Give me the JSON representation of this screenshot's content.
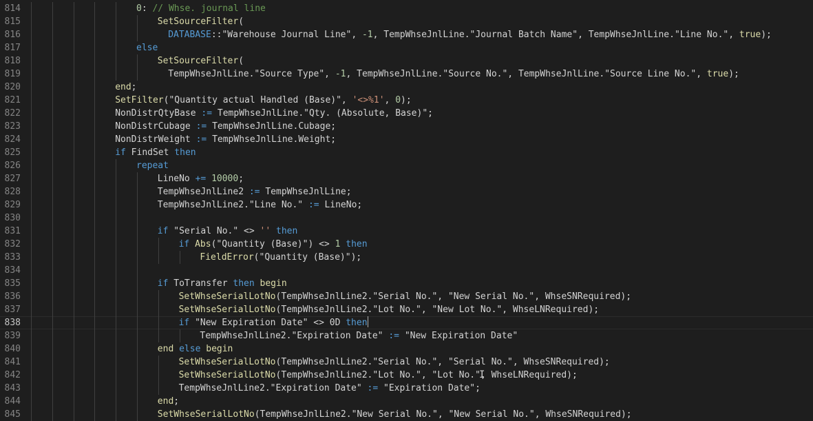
{
  "editor": {
    "lines": [
      {
        "n": "814",
        "indent": 5,
        "parts": [
          [
            "0",
            "num"
          ],
          [
            ": ",
            "plain"
          ],
          [
            "// Whse. journal line",
            "cmt"
          ]
        ]
      },
      {
        "n": "815",
        "indent": 6,
        "parts": [
          [
            "SetSourceFilter",
            "fn"
          ],
          [
            "(",
            "plain"
          ]
        ]
      },
      {
        "n": "816",
        "indent": 6.5,
        "parts": [
          [
            "DATABASE",
            "kw"
          ],
          [
            "::",
            "plain"
          ],
          [
            "\"Warehouse Journal Line\"",
            "plain"
          ],
          [
            ", ",
            "plain"
          ],
          [
            "-1",
            "num"
          ],
          [
            ", ",
            "plain"
          ],
          [
            "TempWhseJnlLine",
            "plain"
          ],
          [
            ".",
            "plain"
          ],
          [
            "\"Journal Batch Name\"",
            "plain"
          ],
          [
            ", ",
            "plain"
          ],
          [
            "TempWhseJnlLine",
            "plain"
          ],
          [
            ".",
            "plain"
          ],
          [
            "\"Line No.\"",
            "plain"
          ],
          [
            ", ",
            "plain"
          ],
          [
            "true",
            "fn"
          ],
          [
            ");",
            "plain"
          ]
        ]
      },
      {
        "n": "817",
        "indent": 5,
        "parts": [
          [
            "else",
            "kw"
          ]
        ]
      },
      {
        "n": "818",
        "indent": 6,
        "parts": [
          [
            "SetSourceFilter",
            "fn"
          ],
          [
            "(",
            "plain"
          ]
        ]
      },
      {
        "n": "819",
        "indent": 6.5,
        "parts": [
          [
            "TempWhseJnlLine",
            "plain"
          ],
          [
            ".",
            "plain"
          ],
          [
            "\"Source Type\"",
            "plain"
          ],
          [
            ", ",
            "plain"
          ],
          [
            "-1",
            "num"
          ],
          [
            ", ",
            "plain"
          ],
          [
            "TempWhseJnlLine",
            "plain"
          ],
          [
            ".",
            "plain"
          ],
          [
            "\"Source No.\"",
            "plain"
          ],
          [
            ", ",
            "plain"
          ],
          [
            "TempWhseJnlLine",
            "plain"
          ],
          [
            ".",
            "plain"
          ],
          [
            "\"Source Line No.\"",
            "plain"
          ],
          [
            ", ",
            "plain"
          ],
          [
            "true",
            "fn"
          ],
          [
            ");",
            "plain"
          ]
        ]
      },
      {
        "n": "820",
        "indent": 4,
        "parts": [
          [
            "end",
            "fn"
          ],
          [
            ";",
            "plain"
          ]
        ]
      },
      {
        "n": "821",
        "indent": 4,
        "parts": [
          [
            "SetFilter",
            "fn"
          ],
          [
            "(",
            "plain"
          ],
          [
            "\"Quantity actual Handled (Base)\"",
            "plain"
          ],
          [
            ", ",
            "plain"
          ],
          [
            "'<>%1'",
            "str"
          ],
          [
            ", ",
            "plain"
          ],
          [
            "0",
            "num"
          ],
          [
            ");",
            "plain"
          ]
        ]
      },
      {
        "n": "822",
        "indent": 4,
        "parts": [
          [
            "NonDistrQtyBase",
            "plain"
          ],
          [
            " := ",
            "kw"
          ],
          [
            "TempWhseJnlLine",
            "plain"
          ],
          [
            ".",
            "plain"
          ],
          [
            "\"Qty. (Absolute, Base)\"",
            "plain"
          ],
          [
            ";",
            "plain"
          ]
        ]
      },
      {
        "n": "823",
        "indent": 4,
        "parts": [
          [
            "NonDistrCubage",
            "plain"
          ],
          [
            " := ",
            "kw"
          ],
          [
            "TempWhseJnlLine",
            "plain"
          ],
          [
            ".",
            "plain"
          ],
          [
            "Cubage",
            "plain"
          ],
          [
            ";",
            "plain"
          ]
        ]
      },
      {
        "n": "824",
        "indent": 4,
        "parts": [
          [
            "NonDistrWeight",
            "plain"
          ],
          [
            " := ",
            "kw"
          ],
          [
            "TempWhseJnlLine",
            "plain"
          ],
          [
            ".",
            "plain"
          ],
          [
            "Weight",
            "plain"
          ],
          [
            ";",
            "plain"
          ]
        ]
      },
      {
        "n": "825",
        "indent": 4,
        "parts": [
          [
            "if",
            "kw"
          ],
          [
            " FindSet ",
            "plain"
          ],
          [
            "then",
            "kw"
          ]
        ]
      },
      {
        "n": "826",
        "indent": 5,
        "parts": [
          [
            "repeat",
            "kw"
          ]
        ]
      },
      {
        "n": "827",
        "indent": 6,
        "parts": [
          [
            "LineNo",
            "plain"
          ],
          [
            " += ",
            "kw"
          ],
          [
            "10000",
            "num"
          ],
          [
            ";",
            "plain"
          ]
        ]
      },
      {
        "n": "828",
        "indent": 6,
        "parts": [
          [
            "TempWhseJnlLine2",
            "plain"
          ],
          [
            " := ",
            "kw"
          ],
          [
            "TempWhseJnlLine",
            "plain"
          ],
          [
            ";",
            "plain"
          ]
        ]
      },
      {
        "n": "829",
        "indent": 6,
        "parts": [
          [
            "TempWhseJnlLine2",
            "plain"
          ],
          [
            ".",
            "plain"
          ],
          [
            "\"Line No.\"",
            "plain"
          ],
          [
            " := ",
            "kw"
          ],
          [
            "LineNo",
            "plain"
          ],
          [
            ";",
            "plain"
          ]
        ]
      },
      {
        "n": "830",
        "indent": 6,
        "parts": []
      },
      {
        "n": "831",
        "indent": 6,
        "parts": [
          [
            "if",
            "kw"
          ],
          [
            " \"Serial No.\" <> ",
            "plain"
          ],
          [
            "''",
            "str"
          ],
          [
            " ",
            "plain"
          ],
          [
            "then",
            "kw"
          ]
        ]
      },
      {
        "n": "832",
        "indent": 7,
        "parts": [
          [
            "if",
            "kw"
          ],
          [
            " ",
            "plain"
          ],
          [
            "Abs",
            "fn"
          ],
          [
            "(",
            "plain"
          ],
          [
            "\"Quantity (Base)\"",
            "plain"
          ],
          [
            ") <> ",
            "plain"
          ],
          [
            "1",
            "num"
          ],
          [
            " ",
            "plain"
          ],
          [
            "then",
            "kw"
          ]
        ]
      },
      {
        "n": "833",
        "indent": 8,
        "parts": [
          [
            "FieldError",
            "fn"
          ],
          [
            "(",
            "plain"
          ],
          [
            "\"Quantity (Base)\"",
            "plain"
          ],
          [
            ");",
            "plain"
          ]
        ]
      },
      {
        "n": "834",
        "indent": 6,
        "parts": []
      },
      {
        "n": "835",
        "indent": 6,
        "parts": [
          [
            "if",
            "kw"
          ],
          [
            " ToTransfer ",
            "plain"
          ],
          [
            "then",
            "kw"
          ],
          [
            " ",
            "plain"
          ],
          [
            "begin",
            "fn"
          ]
        ]
      },
      {
        "n": "836",
        "indent": 7,
        "parts": [
          [
            "SetWhseSerialLotNo",
            "fn"
          ],
          [
            "(",
            "plain"
          ],
          [
            "TempWhseJnlLine2",
            "plain"
          ],
          [
            ".",
            "plain"
          ],
          [
            "\"Serial No.\"",
            "plain"
          ],
          [
            ", ",
            "plain"
          ],
          [
            "\"New Serial No.\"",
            "plain"
          ],
          [
            ", ",
            "plain"
          ],
          [
            "WhseSNRequired",
            "plain"
          ],
          [
            ");",
            "plain"
          ]
        ]
      },
      {
        "n": "837",
        "indent": 7,
        "parts": [
          [
            "SetWhseSerialLotNo",
            "fn"
          ],
          [
            "(",
            "plain"
          ],
          [
            "TempWhseJnlLine2",
            "plain"
          ],
          [
            ".",
            "plain"
          ],
          [
            "\"Lot No.\"",
            "plain"
          ],
          [
            ", ",
            "plain"
          ],
          [
            "\"New Lot No.\"",
            "plain"
          ],
          [
            ", ",
            "plain"
          ],
          [
            "WhseLNRequired",
            "plain"
          ],
          [
            ");",
            "plain"
          ]
        ]
      },
      {
        "n": "838",
        "indent": 7,
        "current": true,
        "parts": [
          [
            "if",
            "kw"
          ],
          [
            " \"New Expiration Date\" <> 0D ",
            "plain"
          ],
          [
            "then",
            "kw"
          ]
        ]
      },
      {
        "n": "839",
        "indent": 8,
        "parts": [
          [
            "TempWhseJnlLine2",
            "plain"
          ],
          [
            ".",
            "plain"
          ],
          [
            "\"Expiration Date\"",
            "plain"
          ],
          [
            " := ",
            "kw"
          ],
          [
            "\"New Expiration Date\"",
            "plain"
          ]
        ]
      },
      {
        "n": "840",
        "indent": 6,
        "parts": [
          [
            "end",
            "fn"
          ],
          [
            " ",
            "plain"
          ],
          [
            "else",
            "kw"
          ],
          [
            " ",
            "plain"
          ],
          [
            "begin",
            "fn"
          ]
        ]
      },
      {
        "n": "841",
        "indent": 7,
        "parts": [
          [
            "SetWhseSerialLotNo",
            "fn"
          ],
          [
            "(",
            "plain"
          ],
          [
            "TempWhseJnlLine2",
            "plain"
          ],
          [
            ".",
            "plain"
          ],
          [
            "\"Serial No.\"",
            "plain"
          ],
          [
            ", ",
            "plain"
          ],
          [
            "\"Serial No.\"",
            "plain"
          ],
          [
            ", ",
            "plain"
          ],
          [
            "WhseSNRequired",
            "plain"
          ],
          [
            ");",
            "plain"
          ]
        ]
      },
      {
        "n": "842",
        "indent": 7,
        "parts": [
          [
            "SetWhseSerialLotNo",
            "fn"
          ],
          [
            "(",
            "plain"
          ],
          [
            "TempWhseJnlLine2",
            "plain"
          ],
          [
            ".",
            "plain"
          ],
          [
            "\"Lot No.\"",
            "plain"
          ],
          [
            ", ",
            "plain"
          ],
          [
            "\"Lot No.\"",
            "plain"
          ],
          [
            ", ",
            "plain"
          ],
          [
            "WhseLNRequired",
            "plain"
          ],
          [
            ");",
            "plain"
          ]
        ]
      },
      {
        "n": "843",
        "indent": 7,
        "parts": [
          [
            "TempWhseJnlLine2",
            "plain"
          ],
          [
            ".",
            "plain"
          ],
          [
            "\"Expiration Date\"",
            "plain"
          ],
          [
            " := ",
            "kw"
          ],
          [
            "\"Expiration Date\"",
            "plain"
          ],
          [
            ";",
            "plain"
          ]
        ]
      },
      {
        "n": "844",
        "indent": 6,
        "parts": [
          [
            "end",
            "fn"
          ],
          [
            ";",
            "plain"
          ]
        ]
      },
      {
        "n": "845",
        "indent": 6,
        "parts": [
          [
            "SetWhseSerialLotNo",
            "fn"
          ],
          [
            "(",
            "plain"
          ],
          [
            "TempWhseJnlLine2",
            "plain"
          ],
          [
            ".",
            "plain"
          ],
          [
            "\"New Serial No.\"",
            "plain"
          ],
          [
            ", ",
            "plain"
          ],
          [
            "\"New Serial No.\"",
            "plain"
          ],
          [
            ", ",
            "plain"
          ],
          [
            "WhseSNRequired",
            "plain"
          ],
          [
            ");",
            "plain"
          ]
        ]
      }
    ]
  },
  "colors": {
    "background": "#1e1e1e",
    "keyword": "#569cd6",
    "control": "#c586c0",
    "function": "#dcdcaa",
    "string": "#ce9178",
    "number": "#b5cea8",
    "comment": "#6a9955",
    "text": "#d4d4d4",
    "line_number": "#858585"
  }
}
